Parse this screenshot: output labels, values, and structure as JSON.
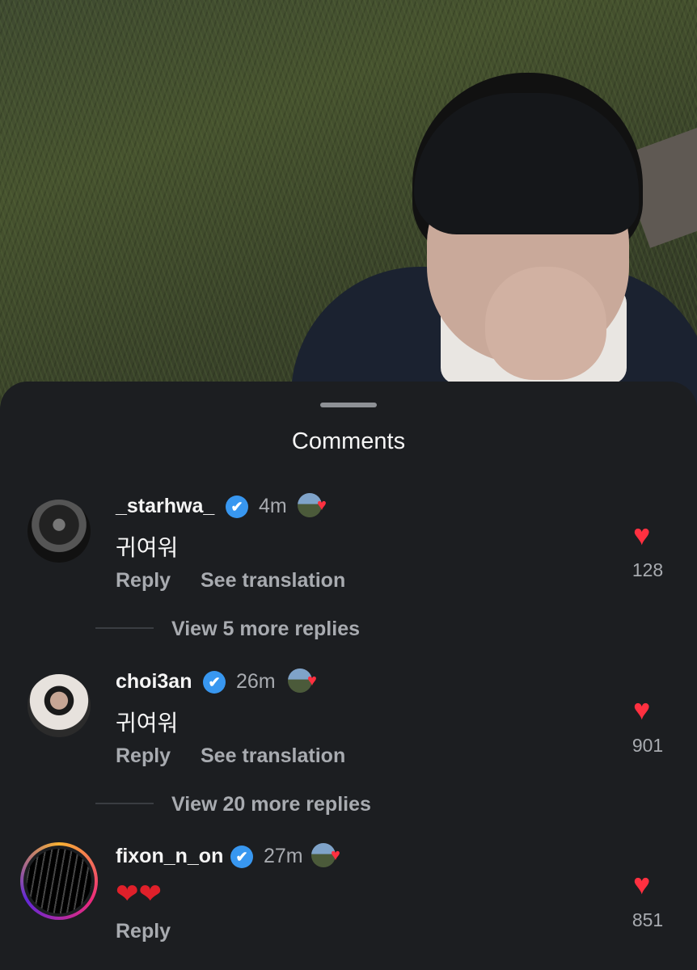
{
  "sheet": {
    "title": "Comments"
  },
  "comments": [
    {
      "username": "_starhwa_",
      "verified_mark": "✔",
      "time": "4m",
      "text": "귀여워",
      "reply_label": "Reply",
      "translate_label": "See translation",
      "like_icon": "♥",
      "likes": "128",
      "view_replies": "View 5 more replies"
    },
    {
      "username": "choi3an",
      "verified_mark": "✔",
      "time": "26m",
      "text": "귀여워",
      "reply_label": "Reply",
      "translate_label": "See translation",
      "like_icon": "♥",
      "likes": "901",
      "view_replies": "View 20 more replies"
    },
    {
      "username": "fixon_n_on",
      "verified_mark": "✔",
      "time": "27m",
      "text": "❤❤",
      "reply_label": "Reply",
      "like_icon": "♥",
      "likes": "851"
    }
  ],
  "icons": {
    "mini_heart": "♥"
  },
  "colors": {
    "sheet_bg": "#1c1e21",
    "like_red": "#ff3040",
    "verified_blue": "#3897f0",
    "secondary_text": "#a8abb0"
  }
}
